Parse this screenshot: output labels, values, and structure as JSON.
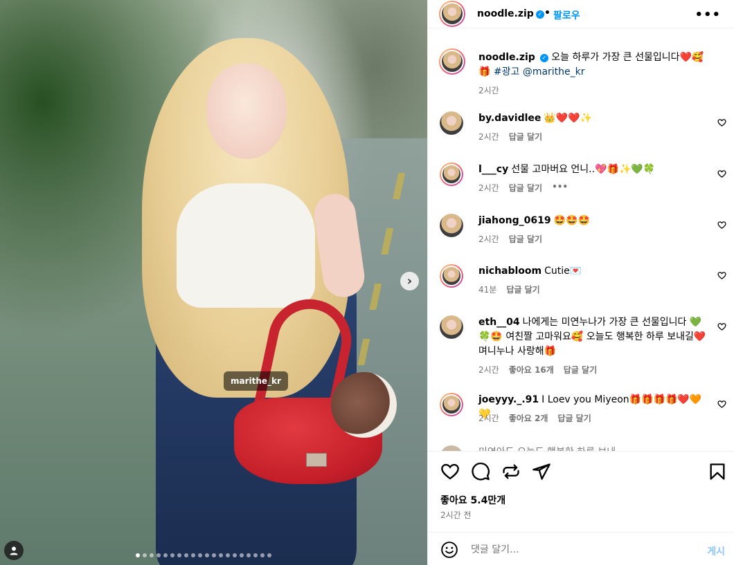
{
  "post": {
    "username": "noodle.zip",
    "follow_label": "팔로우",
    "dot": "•",
    "more": "•••",
    "media_tag": "marithe_kr",
    "next_arrow": "›",
    "carousel_count": 20,
    "carousel_active": 0
  },
  "caption": {
    "username": "noodle.zip",
    "text": "오늘 하루가 가장 큰 선물입니다❤️🥰",
    "hashtag": "🎁 #광고 @marithe_kr",
    "time": "2시간"
  },
  "comments": [
    {
      "username": "by.davidlee",
      "text": "👑❤️❤️✨",
      "time": "2시간",
      "reply": "답글 달기",
      "likes": "",
      "more": ""
    },
    {
      "username": "l___cy",
      "text": "선물 고마버요 언니..💖🎁✨💚🍀",
      "time": "2시간",
      "reply": "답글 달기",
      "likes": "",
      "more": "•••"
    },
    {
      "username": "jiahong_0619",
      "text": "🤩🤩🤩",
      "time": "2시간",
      "reply": "답글 달기",
      "likes": "",
      "more": ""
    },
    {
      "username": "nichabloom",
      "text": "Cutie💌",
      "time": "41분",
      "reply": "답글 달기",
      "likes": "",
      "more": ""
    },
    {
      "username": "eth__04",
      "text": "나에게는 미연누나가 가장 큰 선물입니다 💚🍀🤩 여친짤 고마워요🥰 오늘도 행복한 하루 보내길❤️며니누나 사랑해🎁",
      "time": "2시간",
      "reply": "답글 달기",
      "likes": "좋아요 16개",
      "more": ""
    },
    {
      "username": "joeyyy._.91",
      "text": "I Loev you Miyeon🎁🎁🎁🎁❤️🧡💛",
      "time": "2시간",
      "reply": "답글 달기",
      "likes": "좋아요 2개",
      "more": ""
    }
  ],
  "partial_comment": "미연아도 오늘도 행복한 하루 보내",
  "stats": {
    "likes": "좋아요 5.4만개",
    "time": "2시간 전"
  },
  "composer": {
    "placeholder": "댓글 달기...",
    "post_label": "게시"
  },
  "colors": {
    "accent": "#0095f6",
    "muted": "#737373",
    "bag_red": "#c51f2a"
  }
}
